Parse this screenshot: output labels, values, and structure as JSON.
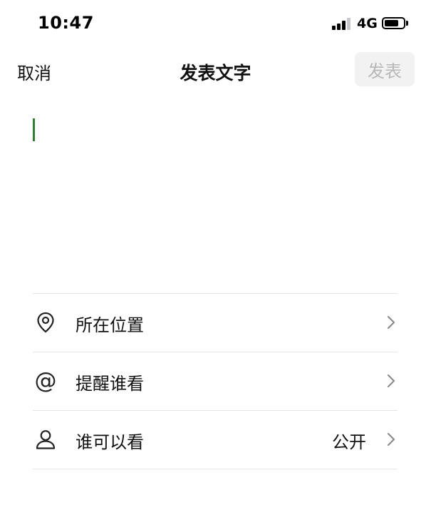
{
  "status_bar": {
    "time": "10:47",
    "network": "4G",
    "battery_level": 0.75
  },
  "nav": {
    "cancel_label": "取消",
    "title": "发表文字",
    "publish_label": "发表"
  },
  "editor": {
    "value": "",
    "cursor_color": "#2e7d32"
  },
  "options": {
    "location": {
      "label": "所在位置",
      "icon": "location-pin-icon"
    },
    "mention": {
      "label": "提醒谁看",
      "icon": "at-icon"
    },
    "visibility": {
      "label": "谁可以看",
      "value": "公开",
      "icon": "person-icon"
    }
  },
  "colors": {
    "publish_disabled_bg": "#f2f2f2",
    "publish_disabled_text": "#b8b8b8",
    "divider": "#e6e6e6",
    "chevron": "#8c8c8c"
  }
}
